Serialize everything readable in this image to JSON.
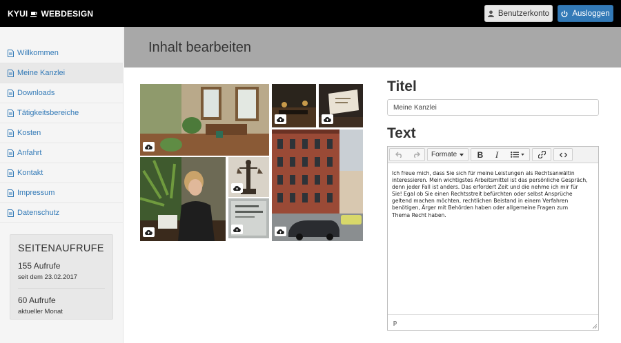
{
  "brand": {
    "name": "KYUI ☕ WEBDESIGN",
    "name_left": "KYUI",
    "name_right": "WEBDESIGN"
  },
  "header": {
    "account_label": "Benutzerkonto",
    "logout_label": "Ausloggen"
  },
  "sidebar": {
    "items": [
      {
        "label": "Willkommen",
        "active": false
      },
      {
        "label": "Meine Kanzlei",
        "active": true
      },
      {
        "label": "Downloads",
        "active": false
      },
      {
        "label": "Tätigkeitsbereiche",
        "active": false
      },
      {
        "label": "Kosten",
        "active": false
      },
      {
        "label": "Anfahrt",
        "active": false
      },
      {
        "label": "Kontakt",
        "active": false
      },
      {
        "label": "Impressum",
        "active": false
      },
      {
        "label": "Datenschutz",
        "active": false
      }
    ],
    "stats": {
      "title": "SEITENAUFRUFE",
      "total": "155 Aufrufe",
      "total_sub": "seit dem 23.02.2017",
      "month": "60 Aufrufe",
      "month_sub": "aktueller Monat"
    }
  },
  "main": {
    "page_title": "Inhalt bearbeiten"
  },
  "form": {
    "title_label": "Titel",
    "title_value": "Meine Kanzlei",
    "text_label": "Text",
    "toolbar": {
      "format_label": "Formate"
    },
    "text_lines": [
      "Ich freue mich, dass Sie sich für meine Leistungen als Rechtsanwältin",
      "interessieren. Mein wichtigstes Arbeitsmittel ist das persönliche Gespräch,",
      "denn jeder Fall ist anders. Das erfordert Zeit und die nehme ich mir für",
      "Sie! Egal ob Sie einen Rechtsstreit befürchten oder selbst Ansprüche",
      "geltend machen möchten, rechtlichen Beistand in einem Verfahren",
      "benötigen, Ärger mit Behörden haben oder allgemeine Fragen zum",
      "Thema Recht haben."
    ],
    "status_path": "p"
  },
  "colors": {
    "primary": "#337ab7",
    "topbar": "#000000",
    "header_band": "#a8a8a8",
    "sidebar_bg": "#f5f5f5"
  },
  "icons": [
    "coffee-icon",
    "user-icon",
    "power-icon",
    "file-icon",
    "upload-icon",
    "undo-icon",
    "redo-icon",
    "bold-icon",
    "italic-icon",
    "list-icon",
    "link-icon",
    "code-icon",
    "resize-handle-icon"
  ]
}
